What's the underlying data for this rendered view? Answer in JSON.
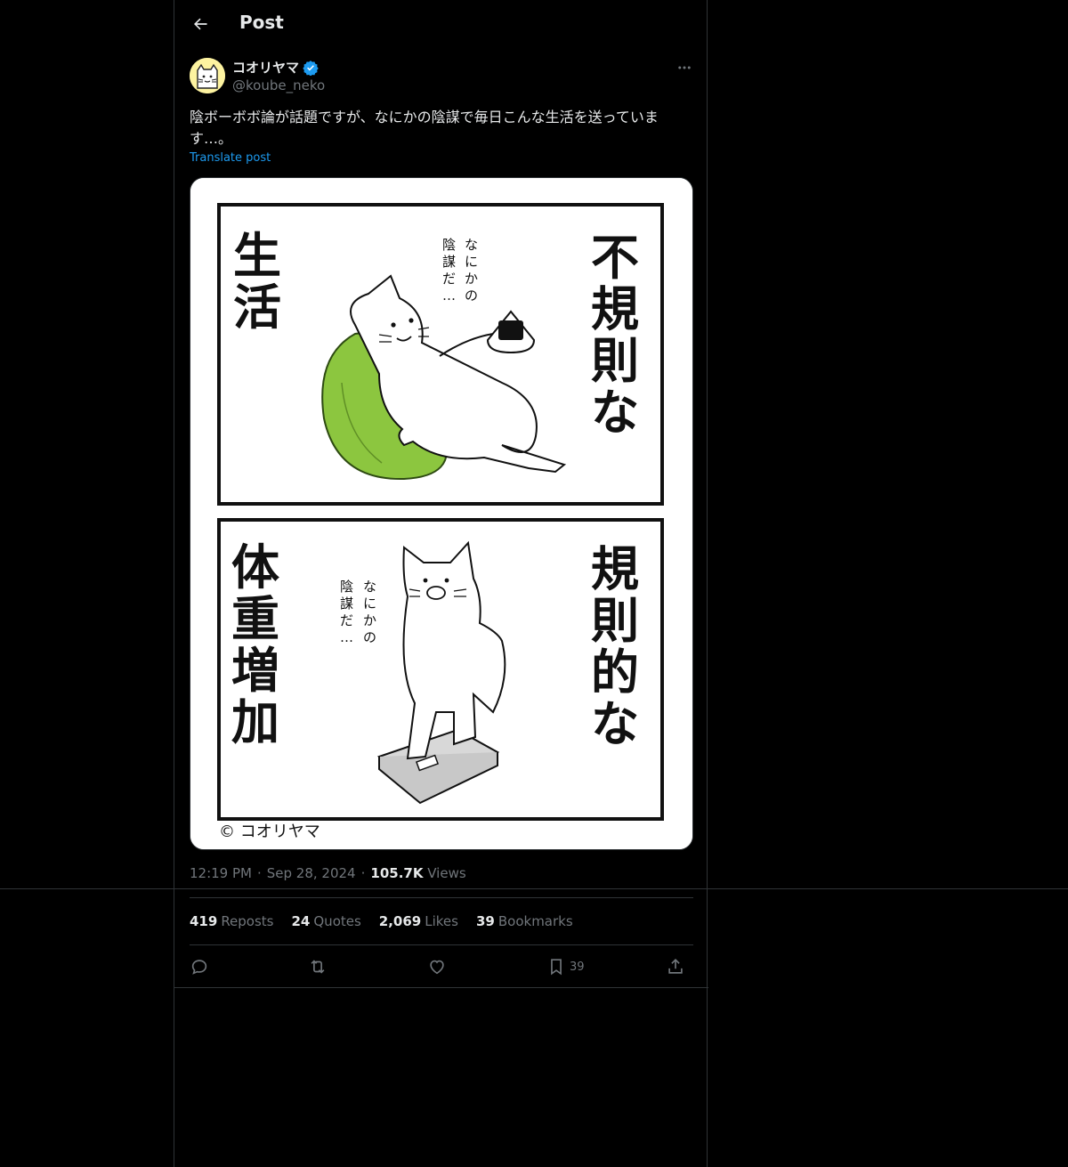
{
  "header": {
    "title": "Post"
  },
  "author": {
    "display_name": "コオリヤマ",
    "handle": "@koube_neko",
    "verified": true
  },
  "post": {
    "text": "陰ボーボボ論が話題ですが、なにかの陰謀で毎日こんな生活を送っています…。",
    "translate_label": "Translate post",
    "time": "12:19 PM",
    "date": "Sep 28, 2024",
    "views_count": "105.7K",
    "views_label": "Views"
  },
  "comic": {
    "panel1_title_right": "不規則な",
    "panel1_title_left": "生活",
    "panel1_whisper": "なにかの陰謀だ…",
    "panel2_title_right": "規則的な",
    "panel2_title_left": "体重増加",
    "panel2_whisper": "なにかの陰謀だ…",
    "credit": "© コオリヤマ"
  },
  "stats": {
    "reposts_count": "419",
    "reposts_label": "Reposts",
    "quotes_count": "24",
    "quotes_label": "Quotes",
    "likes_count": "2,069",
    "likes_label": "Likes",
    "bookmarks_count": "39",
    "bookmarks_label": "Bookmarks"
  },
  "actions": {
    "bookmark_count": "39"
  },
  "colors": {
    "accent": "#1d9bf0",
    "background": "#000000",
    "border": "#2f3336",
    "muted": "#71767b"
  }
}
